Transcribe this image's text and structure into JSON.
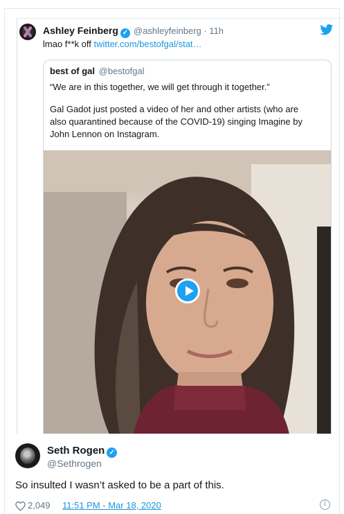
{
  "inner_tweet": {
    "author_name": "Ashley Feinberg",
    "handle_time": "@ashleyfeinberg · 11h",
    "text_prefix": "lmao f**k off ",
    "link": "twitter.com/bestofgal/stat…"
  },
  "quoted_tweet": {
    "name": "best of gal",
    "handle": "@bestofgal",
    "line1": "“We are in this together, we will get through it together.”",
    "line2": "Gal Gadot just posted a video of her and other artists (who are",
    "line3": "also quarantined because of the COVID-19) singing Imagine by",
    "line4": "John Lennon on Instagram."
  },
  "outer_tweet": {
    "name": "Seth Rogen",
    "handle": "@Sethrogen",
    "text": "So insulted I wasn’t asked to be a part of this.",
    "likes": "2,049",
    "timestamp": "11:51 PM - Mar 18, 2020"
  },
  "icons": {
    "verified": "verified-badge-icon",
    "twitter": "twitter-bird-icon",
    "heart": "heart-icon",
    "info": "info-icon",
    "play": "play-icon"
  },
  "colors": {
    "accent": "#1da1f2",
    "link": "#1b95e0",
    "muted": "#657786"
  }
}
